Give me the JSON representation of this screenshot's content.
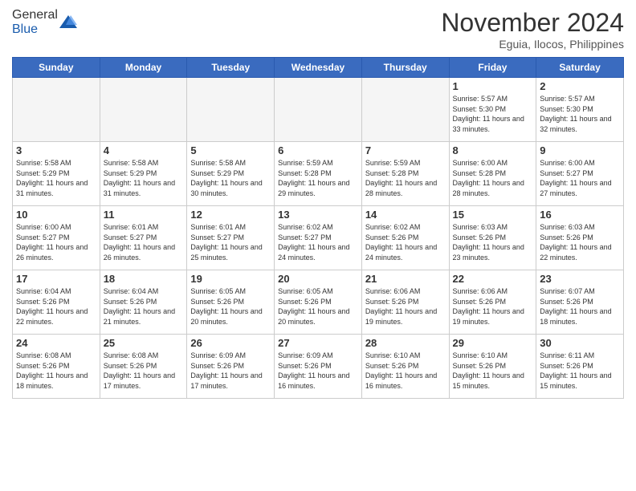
{
  "logo": {
    "general": "General",
    "blue": "Blue"
  },
  "header": {
    "month_year": "November 2024",
    "location": "Eguia, Ilocos, Philippines"
  },
  "weekdays": [
    "Sunday",
    "Monday",
    "Tuesday",
    "Wednesday",
    "Thursday",
    "Friday",
    "Saturday"
  ],
  "weeks": [
    [
      {
        "day": "",
        "empty": true
      },
      {
        "day": "",
        "empty": true
      },
      {
        "day": "",
        "empty": true
      },
      {
        "day": "",
        "empty": true
      },
      {
        "day": "",
        "empty": true
      },
      {
        "day": "1",
        "sunrise": "5:57 AM",
        "sunset": "5:30 PM",
        "daylight": "11 hours and 33 minutes."
      },
      {
        "day": "2",
        "sunrise": "5:57 AM",
        "sunset": "5:30 PM",
        "daylight": "11 hours and 32 minutes."
      }
    ],
    [
      {
        "day": "3",
        "sunrise": "5:58 AM",
        "sunset": "5:29 PM",
        "daylight": "11 hours and 31 minutes."
      },
      {
        "day": "4",
        "sunrise": "5:58 AM",
        "sunset": "5:29 PM",
        "daylight": "11 hours and 31 minutes."
      },
      {
        "day": "5",
        "sunrise": "5:58 AM",
        "sunset": "5:29 PM",
        "daylight": "11 hours and 30 minutes."
      },
      {
        "day": "6",
        "sunrise": "5:59 AM",
        "sunset": "5:28 PM",
        "daylight": "11 hours and 29 minutes."
      },
      {
        "day": "7",
        "sunrise": "5:59 AM",
        "sunset": "5:28 PM",
        "daylight": "11 hours and 28 minutes."
      },
      {
        "day": "8",
        "sunrise": "6:00 AM",
        "sunset": "5:28 PM",
        "daylight": "11 hours and 28 minutes."
      },
      {
        "day": "9",
        "sunrise": "6:00 AM",
        "sunset": "5:27 PM",
        "daylight": "11 hours and 27 minutes."
      }
    ],
    [
      {
        "day": "10",
        "sunrise": "6:00 AM",
        "sunset": "5:27 PM",
        "daylight": "11 hours and 26 minutes."
      },
      {
        "day": "11",
        "sunrise": "6:01 AM",
        "sunset": "5:27 PM",
        "daylight": "11 hours and 26 minutes."
      },
      {
        "day": "12",
        "sunrise": "6:01 AM",
        "sunset": "5:27 PM",
        "daylight": "11 hours and 25 minutes."
      },
      {
        "day": "13",
        "sunrise": "6:02 AM",
        "sunset": "5:27 PM",
        "daylight": "11 hours and 24 minutes."
      },
      {
        "day": "14",
        "sunrise": "6:02 AM",
        "sunset": "5:26 PM",
        "daylight": "11 hours and 24 minutes."
      },
      {
        "day": "15",
        "sunrise": "6:03 AM",
        "sunset": "5:26 PM",
        "daylight": "11 hours and 23 minutes."
      },
      {
        "day": "16",
        "sunrise": "6:03 AM",
        "sunset": "5:26 PM",
        "daylight": "11 hours and 22 minutes."
      }
    ],
    [
      {
        "day": "17",
        "sunrise": "6:04 AM",
        "sunset": "5:26 PM",
        "daylight": "11 hours and 22 minutes."
      },
      {
        "day": "18",
        "sunrise": "6:04 AM",
        "sunset": "5:26 PM",
        "daylight": "11 hours and 21 minutes."
      },
      {
        "day": "19",
        "sunrise": "6:05 AM",
        "sunset": "5:26 PM",
        "daylight": "11 hours and 20 minutes."
      },
      {
        "day": "20",
        "sunrise": "6:05 AM",
        "sunset": "5:26 PM",
        "daylight": "11 hours and 20 minutes."
      },
      {
        "day": "21",
        "sunrise": "6:06 AM",
        "sunset": "5:26 PM",
        "daylight": "11 hours and 19 minutes."
      },
      {
        "day": "22",
        "sunrise": "6:06 AM",
        "sunset": "5:26 PM",
        "daylight": "11 hours and 19 minutes."
      },
      {
        "day": "23",
        "sunrise": "6:07 AM",
        "sunset": "5:26 PM",
        "daylight": "11 hours and 18 minutes."
      }
    ],
    [
      {
        "day": "24",
        "sunrise": "6:08 AM",
        "sunset": "5:26 PM",
        "daylight": "11 hours and 18 minutes."
      },
      {
        "day": "25",
        "sunrise": "6:08 AM",
        "sunset": "5:26 PM",
        "daylight": "11 hours and 17 minutes."
      },
      {
        "day": "26",
        "sunrise": "6:09 AM",
        "sunset": "5:26 PM",
        "daylight": "11 hours and 17 minutes."
      },
      {
        "day": "27",
        "sunrise": "6:09 AM",
        "sunset": "5:26 PM",
        "daylight": "11 hours and 16 minutes."
      },
      {
        "day": "28",
        "sunrise": "6:10 AM",
        "sunset": "5:26 PM",
        "daylight": "11 hours and 16 minutes."
      },
      {
        "day": "29",
        "sunrise": "6:10 AM",
        "sunset": "5:26 PM",
        "daylight": "11 hours and 15 minutes."
      },
      {
        "day": "30",
        "sunrise": "6:11 AM",
        "sunset": "5:26 PM",
        "daylight": "11 hours and 15 minutes."
      }
    ]
  ]
}
